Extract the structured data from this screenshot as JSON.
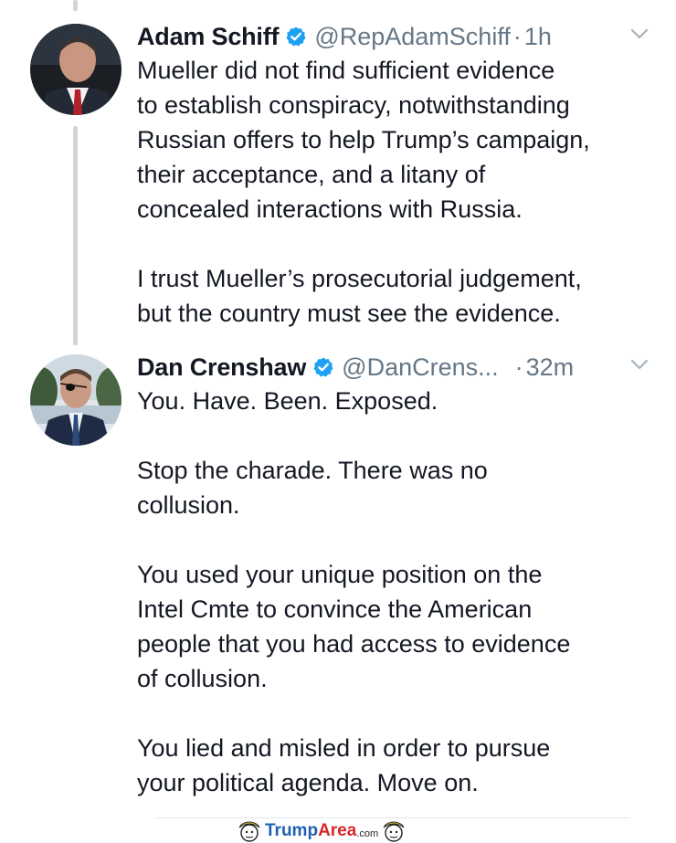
{
  "tweets": [
    {
      "name": "Adam Schiff",
      "handle": "@RepAdamSchiff",
      "separator": "·",
      "time": "1h",
      "paragraphs": [
        [
          "Mueller did not find sufficient evidence",
          "to establish conspiracy, notwithstanding",
          "Russian offers to help Trump’s campaign,",
          "their acceptance, and a litany of",
          "concealed interactions with Russia."
        ],
        [
          "I trust Mueller’s prosecutorial judgement,",
          "but the country must see the evidence."
        ]
      ]
    },
    {
      "name": "Dan Crenshaw",
      "handle": "@DanCrens...",
      "separator": "·",
      "time": "32m",
      "paragraphs": [
        [
          "You. Have. Been. Exposed."
        ],
        [
          "Stop the charade. There was no",
          "collusion."
        ],
        [
          "You used your unique position on the",
          "Intel Cmte to convince the American",
          "people that you had access to evidence",
          "of collusion."
        ],
        [
          "You lied and misled in order to pursue",
          "your political agenda. Move on."
        ]
      ]
    }
  ],
  "watermark": {
    "part1": "Trump",
    "part2": "Area",
    "part3": ".com"
  },
  "colors": {
    "text": "#141823",
    "muted": "#657786",
    "verified": "#1da1f2",
    "thread_line": "#d2d6da"
  },
  "icons": {
    "verified": "verified-badge-icon",
    "menu": "chevron-down-icon"
  }
}
